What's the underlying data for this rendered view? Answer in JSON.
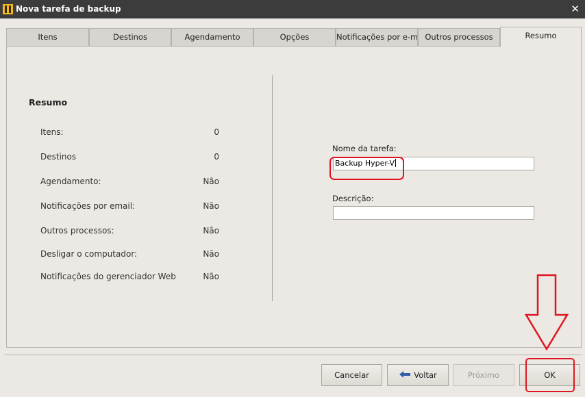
{
  "window": {
    "title": "Nova tarefa de backup",
    "close_glyph": "✕"
  },
  "tabs": [
    {
      "label": "Itens"
    },
    {
      "label": "Destinos"
    },
    {
      "label": "Agendamento"
    },
    {
      "label": "Opções"
    },
    {
      "label": "Notificações por e-mail"
    },
    {
      "label": "Outros processos"
    },
    {
      "label": "Resumo",
      "active": true
    }
  ],
  "summary": {
    "title": "Resumo",
    "rows": [
      {
        "label": "Itens:",
        "value": "0"
      },
      {
        "label": "Destinos",
        "value": "0"
      },
      {
        "label": "Agendamento:",
        "value": "Não"
      },
      {
        "label": "Notificações por email:",
        "value": "Não"
      },
      {
        "label": "Outros processos:",
        "value": "Não"
      },
      {
        "label": "Desligar o computador:",
        "value": "Não"
      },
      {
        "label": "Notificações do gerenciador Web",
        "value": "Não"
      }
    ]
  },
  "form": {
    "task_name_label": "Nome da tarefa:",
    "task_name_value": "Backup Hyper-V",
    "description_label": "Descrição:",
    "description_value": ""
  },
  "buttons": {
    "cancel": "Cancelar",
    "back": "Voltar",
    "next": "Próximo",
    "ok": "OK"
  },
  "colors": {
    "annotation": "#e0151f",
    "titlebar": "#3c3c3c",
    "back_arrow": "#2f5fa8"
  },
  "icons": {
    "app": "app-icon",
    "close": "close-icon",
    "back": "arrow-left-icon"
  }
}
